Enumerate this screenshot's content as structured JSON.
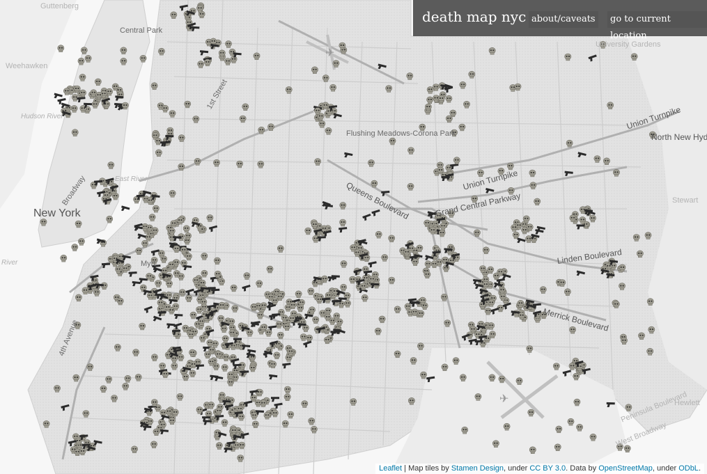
{
  "app": {
    "title": "death map nyc",
    "about_label": "about/caveats",
    "location_label": "go to current location"
  },
  "attribution": {
    "leaflet": "Leaflet",
    "text1": " | Map tiles by ",
    "stamen": "Stamen Design",
    "text2": ", under ",
    "cc": "CC BY 3.0",
    "text3": ". Data by ",
    "osm": "OpenStreetMap",
    "text4": ", under ",
    "odbl": "ODbL",
    "text5": "."
  },
  "map_labels": {
    "guttenberg": "Guttenberg",
    "central_park": "Central Park",
    "weehawken": "Weehawken",
    "hudson_river": "Hudson River",
    "broadway": "Broadway",
    "east_river": "East River",
    "new_york": "New York",
    "first_street": "1st Street",
    "flushing": "Flushing Meadows-Corona Park",
    "queens_blvd": "Queens Boulevard",
    "union_tpke": "Union Turnpike",
    "gcp": "Grand Central Parkway",
    "linden": "Linden Boulevard",
    "merrick": "Merrick Boulevard",
    "university": "University Gardens",
    "union_tpke2": "Union Turnpike",
    "north_new_hyde": "North New Hyde",
    "stewart": "Stewart",
    "hewlett": "Hewlett",
    "fourth_ave": "4th Avenue",
    "peninsula": "Peninsula Boulevard",
    "west_broadway": "West Broadway",
    "river": "River",
    "myrtle": "Myrt"
  },
  "legend": {
    "death_marker": "skull-icon",
    "weapon_marker": "gun-icon"
  },
  "colors": {
    "land": "#e4e4e4",
    "water": "#f6f6f6",
    "road": "#c6c6c6",
    "major_road": "#a8a8a8",
    "skull": "#a09e93",
    "gun": "#2b2b2b",
    "header_bg": "#464646"
  }
}
